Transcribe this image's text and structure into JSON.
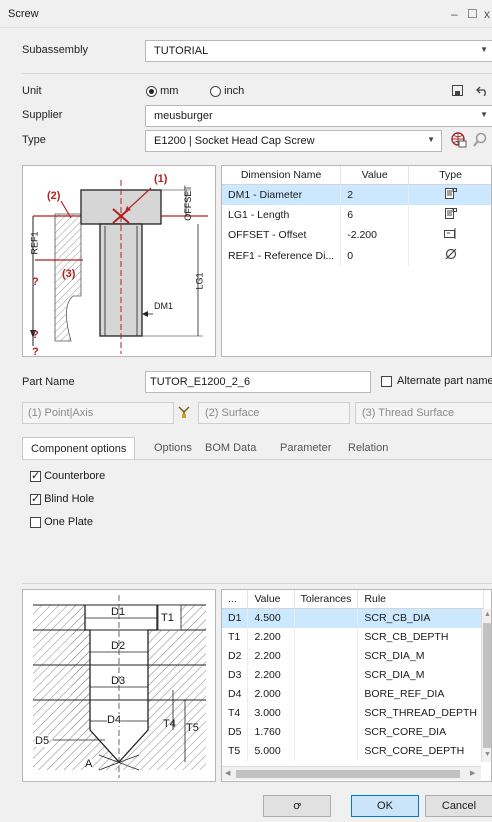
{
  "window": {
    "title": "Screw",
    "min_glyph": "–",
    "max_glyph": "☐",
    "close_glyph": "x"
  },
  "subassembly": {
    "label": "Subassembly",
    "value": "TUTORIAL"
  },
  "unit": {
    "label": "Unit",
    "options": [
      "mm",
      "inch"
    ],
    "selected": "mm"
  },
  "supplier": {
    "label": "Supplier",
    "value": "meusburger"
  },
  "type": {
    "label": "Type",
    "value": "E1200 | Socket Head Cap Screw"
  },
  "drawing_top": {
    "label_1": "(1)",
    "label_2": "(2)",
    "label_3": "(3)",
    "ref1": "REF1",
    "offset": "OFFSET",
    "lg1": "LG1",
    "dm1": "DM1",
    "q1": "?",
    "q2": "?",
    "q3": "?"
  },
  "dimensions_table": {
    "columns": [
      "Dimension Name",
      "Value",
      "Type"
    ],
    "rows": [
      {
        "name": "DM1 - Diameter",
        "value": "2",
        "type_icon": "list-icon"
      },
      {
        "name": "LG1 - Length",
        "value": "6",
        "type_icon": "list-icon"
      },
      {
        "name": "OFFSET - Offset",
        "value": "-2.200",
        "type_icon": "edit-icon"
      },
      {
        "name": "REF1 - Reference Di...",
        "value": "0",
        "type_icon": "diameter-icon"
      }
    ]
  },
  "part_name": {
    "label": "Part Name",
    "value": "TUTOR_E1200_2_6",
    "alternate_label": "Alternate part name"
  },
  "references": {
    "point_axis": "(1) Point|Axis",
    "surface": "(2) Surface",
    "thread_surface": "(3) Thread Surface"
  },
  "tabs": [
    "Component options",
    "Options",
    "BOM Data",
    "Parameter",
    "Relation"
  ],
  "component_options": [
    {
      "label": "Counterbore",
      "checked": true
    },
    {
      "label": "Blind Hole",
      "checked": true
    },
    {
      "label": "One Plate",
      "checked": false
    }
  ],
  "drawing_bottom": {
    "d1": "D1",
    "d2": "D2",
    "d3": "D3",
    "d4": "D4",
    "d5": "D5",
    "t1": "T1",
    "t4": "T4",
    "t5": "T5",
    "a": "A"
  },
  "rules_table": {
    "columns": [
      "...",
      "Value",
      "Tolerances",
      "Rule"
    ],
    "rows": [
      {
        "key": "D1",
        "value": "4.500",
        "tol": "",
        "rule": "SCR_CB_DIA"
      },
      {
        "key": "T1",
        "value": "2.200",
        "tol": "",
        "rule": "SCR_CB_DEPTH"
      },
      {
        "key": "D2",
        "value": "2.200",
        "tol": "",
        "rule": "SCR_DIA_M"
      },
      {
        "key": "D3",
        "value": "2.200",
        "tol": "",
        "rule": "SCR_DIA_M"
      },
      {
        "key": "D4",
        "value": "2.000",
        "tol": "",
        "rule": "BORE_REF_DIA"
      },
      {
        "key": "T4",
        "value": "3.000",
        "tol": "",
        "rule": "SCR_THREAD_DEPTH"
      },
      {
        "key": "D5",
        "value": "1.760",
        "tol": "",
        "rule": "SCR_CORE_DIA"
      },
      {
        "key": "T5",
        "value": "5.000",
        "tol": "",
        "rule": "SCR_CORE_DEPTH"
      }
    ]
  },
  "buttons": {
    "preview": "ꝍ",
    "ok": "OK",
    "cancel": "Cancel"
  }
}
